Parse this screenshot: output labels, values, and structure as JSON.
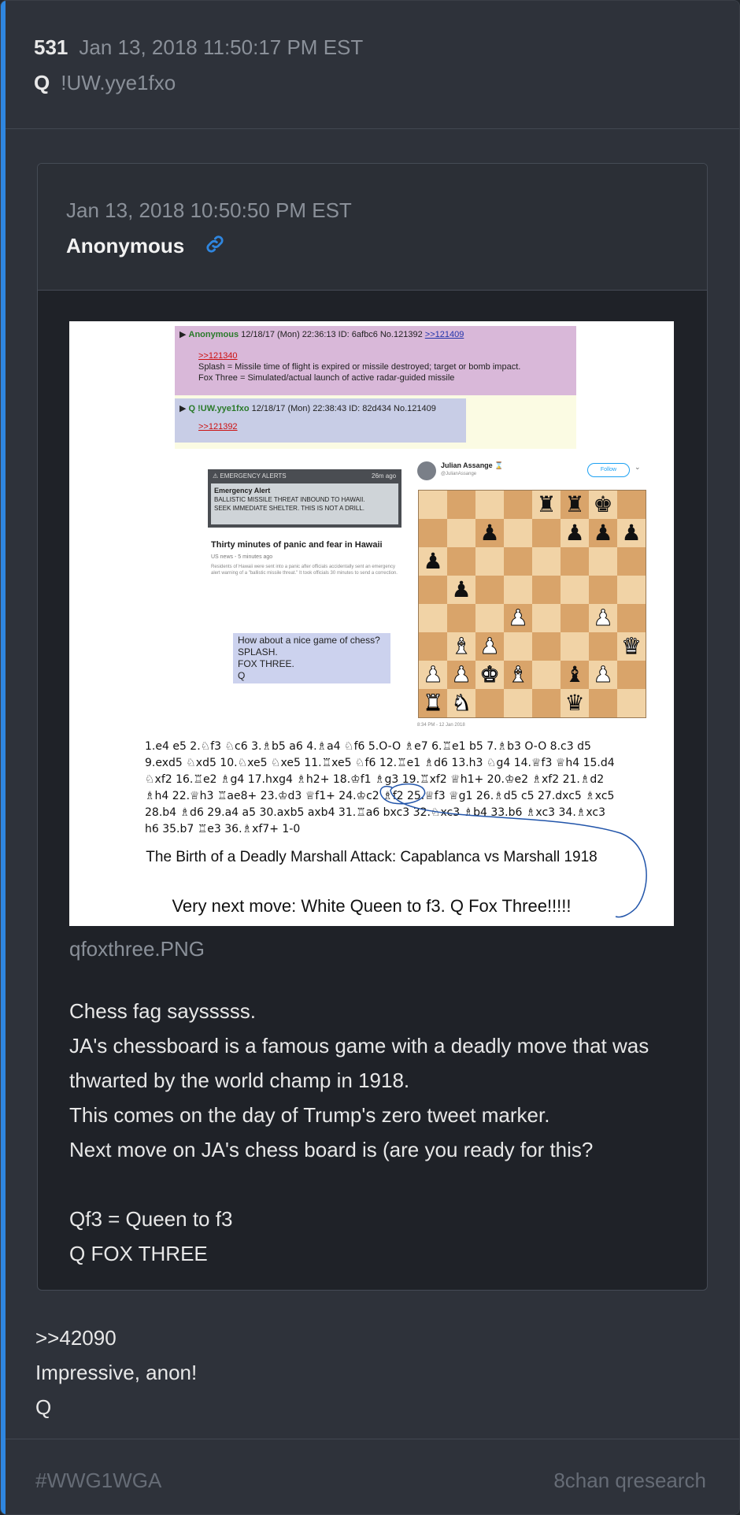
{
  "post": {
    "number": "531",
    "timestamp": "Jan 13, 2018 11:50:17 PM EST",
    "author": "Q",
    "tripcode": "!UW.yye1fxo"
  },
  "quoted_post": {
    "timestamp": "Jan 13, 2018 10:50:50 PM EST",
    "author": "Anonymous",
    "link_icon": "link-icon",
    "image_filename": "qfoxthree.PNG",
    "body_lines": [
      "Chess fag saysssss.",
      "JA's chessboard is a famous game with a deadly move that was",
      "thwarted by the world champ in 1918.",
      "This comes on the day of Trump's zero tweet marker.",
      "Next move on JA's chess board is (are you ready for this?",
      "",
      "Qf3 = Queen to f3",
      "Q FOX THREE"
    ],
    "image": {
      "anon_post": {
        "name": "Anonymous",
        "meta": "12/18/17 (Mon) 22:36:13 ID: 6afbc6 No.121392",
        "reply_link": ">>121409",
        "quote": ">>121340",
        "line1": "Splash =   Missile time of flight is expired or missile destroyed; target or bomb impact.",
        "line2": "Fox Three =   Simulated/actual launch of active radar-guided missile"
      },
      "q_post": {
        "name": "Q !UW.yye1fxo",
        "meta": "12/18/17 (Mon) 22:38:43 ID: 82d434 No.121409",
        "quote": ">>121392"
      },
      "alert": {
        "header": "EMERGENCY ALERTS",
        "time": "26m ago",
        "title": "Emergency Alert",
        "text1": "BALLISTIC MISSILE THREAT INBOUND TO HAWAII.",
        "text2": "SEEK IMMEDIATE SHELTER. THIS IS NOT A DRILL."
      },
      "news": {
        "headline": "Thirty minutes of panic and fear in Hawaii",
        "meta": "US news - 5 minutes ago",
        "body": "Residents of Hawaii were sent into a panic after officials accidentally sent an emergency alert warning of a \"ballistic missile threat.\" It took officials 30 minutes to send a correction."
      },
      "chess_prompt": [
        "How about a nice game of chess?",
        "SPLASH.",
        "FOX THREE.",
        "Q"
      ],
      "tweet": {
        "name": "Julian Assange",
        "handle": "@JulianAssange",
        "follow": "Follow",
        "time": "8:34 PM - 12 Jan 2018"
      },
      "board": [
        [
          "",
          "",
          "",
          "",
          "br",
          "br",
          "bk",
          ""
        ],
        [
          "",
          "",
          "bp",
          "",
          "",
          "bp",
          "bp",
          "bp"
        ],
        [
          "bp",
          "",
          "",
          "",
          "",
          "",
          "",
          ""
        ],
        [
          "",
          "bp",
          "",
          "",
          "",
          "",
          "",
          ""
        ],
        [
          "",
          "",
          "",
          "wp",
          "",
          "",
          "wp",
          ""
        ],
        [
          "",
          "wb",
          "wp",
          "",
          "",
          "",
          "",
          "wq"
        ],
        [
          "wp",
          "wp",
          "wk",
          "wb",
          "",
          "bb",
          "wp",
          ""
        ],
        [
          "wr",
          "wn",
          "",
          "",
          "",
          "bq",
          "",
          ""
        ]
      ],
      "moves": "1.e4 e5  2.♘f3 ♘c6  3.♗b5 a6  4.♗a4 ♘f6  5.O-O ♗e7  6.♖e1 b5  7.♗b3 O-O  8.c3 d5  9.exd5 ♘xd5  10.♘xe5 ♘xe5  11.♖xe5 ♘f6  12.♖e1 ♗d6  13.h3 ♘g4  14.♕f3 ♕h4  15.d4 ♘xf2  16.♖e2 ♗g4  17.hxg4 ♗h2+  18.♔f1 ♗g3  19.♖xf2 ♕h1+  20.♔e2 ♗xf2  21.♗d2 ♗h4  22.♕h3 ♖ae8+  23.♔d3 ♕f1+  24.♔c2 ♗f2  25.♕f3 ♕g1  26.♗d5 c5  27.dxc5 ♗xc5  28.b4 ♗d6  29.a4 a5  30.axb5 axb4  31.♖a6 bxc3  32.♘xc3 ♗b4  33.b6 ♗xc3  34.♗xc3 h6  35.b7 ♖e3  36.♗xf7+ 1-0",
      "title": "The Birth of a Deadly Marshall Attack: Capablanca vs Marshall 1918",
      "next_move": "Very next move: White Queen to f3. Q Fox Three!!!!!"
    }
  },
  "reply_lines": [
    ">>42090",
    "Impressive, anon!",
    "Q"
  ],
  "footer": {
    "tag": "#WWG1WGA",
    "source": "8chan qresearch"
  },
  "colors": {
    "accent": "#2f86df",
    "background": "#2e323a",
    "muted": "#8a9099",
    "link_icon": "#2f86df"
  }
}
